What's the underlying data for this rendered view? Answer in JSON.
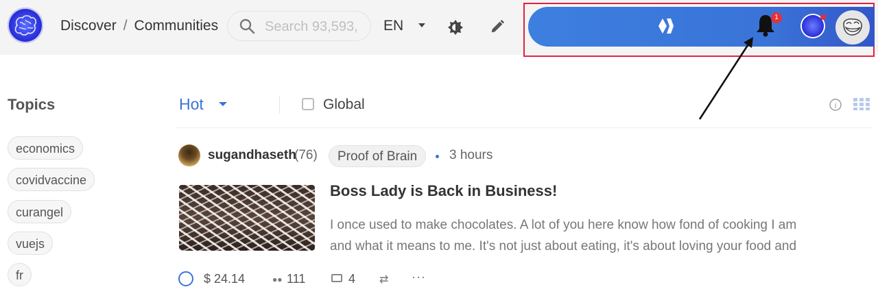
{
  "header": {
    "breadcrumb": [
      "Discover",
      "Communities"
    ],
    "search_placeholder": "Search 93,593,",
    "language": "EN",
    "notifications_count": "1"
  },
  "sidebar": {
    "title": "Topics",
    "tags": [
      "economics",
      "covidvaccine",
      "curangel",
      "vuejs",
      "fr"
    ]
  },
  "feed": {
    "sort": "Hot",
    "global_label": "Global",
    "post": {
      "author": "sugandhaseth",
      "reputation": "(76)",
      "community": "Proof of Brain",
      "time": "3 hours",
      "title": "Boss Lady is Back in Business!",
      "body_lines": [
        "I once used to make chocolates. A lot of you here know how fond of cooking I am",
        "and what it means to me. It's not just about eating, it's about loving your food and"
      ],
      "payout": "$ 24.14",
      "votes": "111",
      "comments": "4"
    }
  },
  "colors": {
    "accent": "#3a73d8",
    "highlight_frame": "#e02040",
    "badge": "#e5303a"
  }
}
